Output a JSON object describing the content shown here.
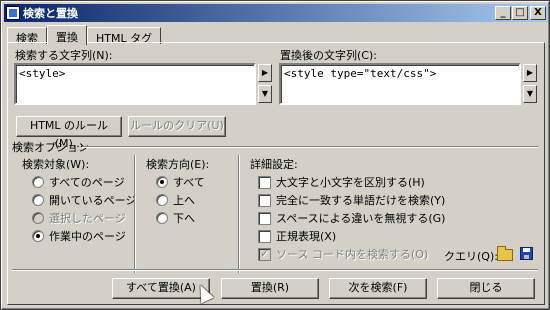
{
  "window": {
    "title": "検索と置換"
  },
  "title_buttons": {
    "minimize": "_",
    "maximize": "□",
    "close": "X"
  },
  "tabs": [
    {
      "label": "検索",
      "active": false
    },
    {
      "label": "置換",
      "active": true
    },
    {
      "label": "HTML タグ",
      "active": false
    }
  ],
  "find": {
    "label": "検索する文字列(N):",
    "value": "<style>"
  },
  "replace": {
    "label": "置換後の文字列(C):",
    "value": "<style type=\"text/css\">"
  },
  "side_buttons": {
    "arrow_right": "▶",
    "arrow_down": "▼"
  },
  "html_rule_button": "HTML のルール(M)...",
  "clear_rule_button": "ルールのクリア(U)",
  "search_options_label": "検索オプション",
  "search_target": {
    "label": "検索対象(W):",
    "options": [
      {
        "label": "すべてのページ",
        "selected": false,
        "disabled": false
      },
      {
        "label": "開いているページ",
        "selected": false,
        "disabled": false
      },
      {
        "label": "選択したページ",
        "selected": false,
        "disabled": true
      },
      {
        "label": "作業中のページ",
        "selected": true,
        "disabled": false
      }
    ]
  },
  "search_direction": {
    "label": "検索方向(E):",
    "options": [
      {
        "label": "すべて",
        "selected": true
      },
      {
        "label": "上へ",
        "selected": false
      },
      {
        "label": "下へ",
        "selected": false
      }
    ]
  },
  "advanced": {
    "label": "詳細設定:",
    "options": [
      {
        "label": "大文字と小文字を区別する(H)",
        "checked": false,
        "disabled": false
      },
      {
        "label": "完全に一致する単語だけを検索(Y)",
        "checked": false,
        "disabled": false
      },
      {
        "label": "スペースによる違いを無視する(G)",
        "checked": false,
        "disabled": false
      },
      {
        "label": "正規表現(X)",
        "checked": false,
        "disabled": false
      },
      {
        "label": "ソース コード内を検索する(O)",
        "checked": true,
        "disabled": true
      }
    ]
  },
  "query": {
    "label": "クエリ(Q):",
    "open_icon": "folder-open-icon",
    "save_icon": "save-icon"
  },
  "bottom_buttons": {
    "replace_all": "すべて置換(A)",
    "replace": "置換(R)",
    "find_next": "次を検索(F)",
    "close": "閉じる"
  }
}
